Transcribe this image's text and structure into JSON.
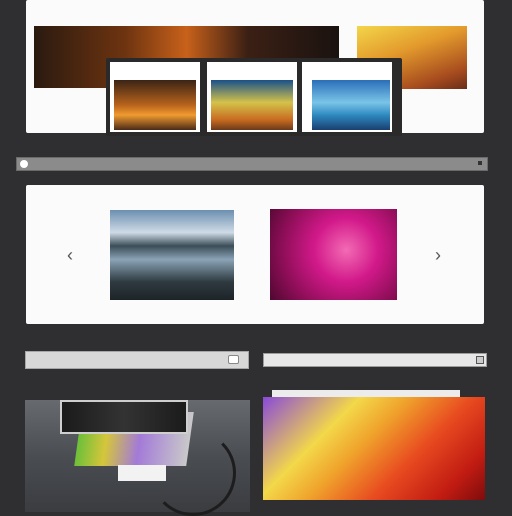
{
  "gallery": {
    "prev_glyph": "‹",
    "next_glyph": "›"
  },
  "icons": {
    "prev": "chevron-left-icon",
    "next": "chevron-right-icon"
  },
  "colors": {
    "background": "#2f2f31",
    "panel": "#fbfbfb",
    "scrollbar": "#8b8b8b"
  }
}
